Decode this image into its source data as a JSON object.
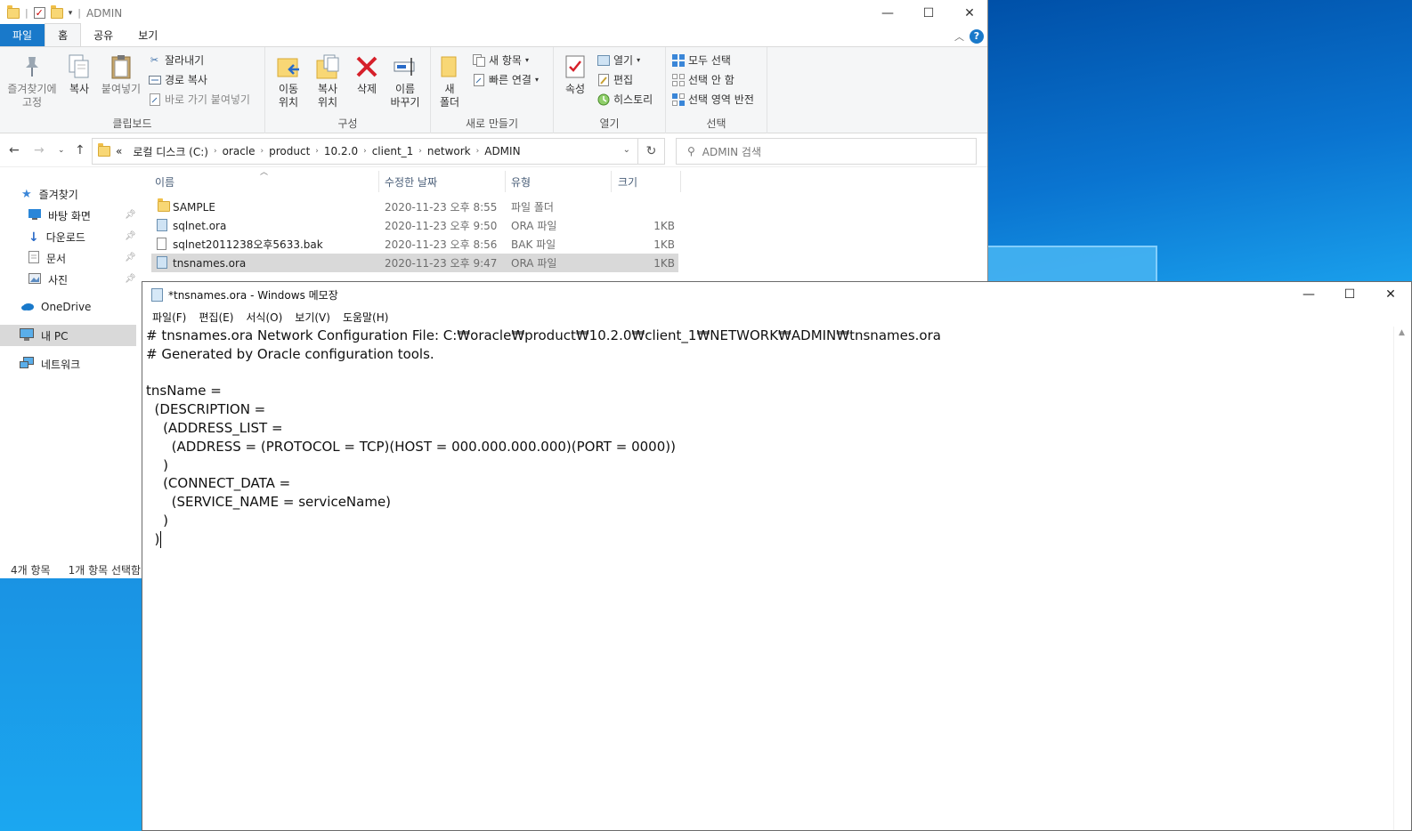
{
  "explorer": {
    "title": "ADMIN",
    "tabs": [
      "파일",
      "홈",
      "공유",
      "보기"
    ],
    "ribbon": {
      "clipboard": {
        "label": "클립보드",
        "pin": "즐겨찾기에\n고정",
        "copy": "복사",
        "paste": "붙여넣기",
        "cut": "잘라내기",
        "copy_path": "경로 복사",
        "paste_shortcut": "바로 가기 붙여넣기"
      },
      "organize": {
        "label": "구성",
        "move_to": "이동\n위치",
        "copy_to": "복사\n위치",
        "delete": "삭제",
        "rename": "이름\n바꾸기"
      },
      "new": {
        "label": "새로 만들기",
        "new_folder": "새\n폴더",
        "new_item": "새 항목",
        "easy_access": "빠른 연결"
      },
      "open": {
        "label": "열기",
        "properties": "속성",
        "open": "열기",
        "edit": "편집",
        "history": "히스토리"
      },
      "select": {
        "label": "선택",
        "select_all": "모두 선택",
        "select_none": "선택 안 함",
        "invert": "선택 영역 반전"
      }
    },
    "breadcrumb": [
      "«",
      "로컬 디스크 (C:)",
      "oracle",
      "product",
      "10.2.0",
      "client_1",
      "network",
      "ADMIN"
    ],
    "search_placeholder": "ADMIN 검색",
    "nav": {
      "favorites": "즐겨찾기",
      "desktop": "바탕 화면",
      "downloads": "다운로드",
      "documents": "문서",
      "pictures": "사진",
      "onedrive": "OneDrive",
      "this_pc": "내 PC",
      "network": "네트워크"
    },
    "columns": {
      "name": "이름",
      "date": "수정한 날짜",
      "type": "유형",
      "size": "크기"
    },
    "files": [
      {
        "name": "SAMPLE",
        "date": "2020-11-23 오후 8:55",
        "type": "파일 폴더",
        "size": ""
      },
      {
        "name": "sqlnet.ora",
        "date": "2020-11-23 오후 9:50",
        "type": "ORA 파일",
        "size": "1KB"
      },
      {
        "name": "sqlnet2011238오후5633.bak",
        "date": "2020-11-23 오후 8:56",
        "type": "BAK 파일",
        "size": "1KB"
      },
      {
        "name": "tnsnames.ora",
        "date": "2020-11-23 오후 9:47",
        "type": "ORA 파일",
        "size": "1KB"
      }
    ],
    "status": {
      "count": "4개 항목",
      "selected": "1개 항목 선택함"
    }
  },
  "notepad": {
    "title": "*tnsnames.ora - Windows 메모장",
    "menu": [
      "파일(F)",
      "편집(E)",
      "서식(O)",
      "보기(V)",
      "도움말(H)"
    ],
    "content": "# tnsnames.ora Network Configuration File: C:₩oracle₩product₩10.2.0₩client_1₩NETWORK₩ADMIN₩tnsnames.ora\n# Generated by Oracle configuration tools.\n\ntnsName =\n  (DESCRIPTION =\n    (ADDRESS_LIST =\n      (ADDRESS = (PROTOCOL = TCP)(HOST = 000.000.000.000)(PORT = 0000))\n    )\n    (CONNECT_DATA =\n      (SERVICE_NAME = serviceName)\n    )\n  )"
  }
}
